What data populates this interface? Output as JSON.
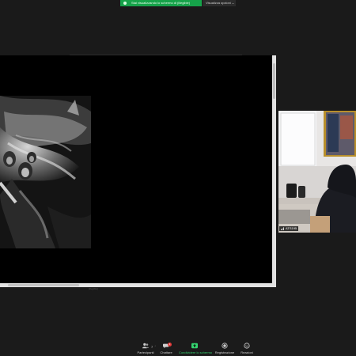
{
  "banner": {
    "text": "Stai visualizzando lo schermo di (illegible)"
  },
  "view_options": {
    "label": "Visualizza opzioni ⌄"
  },
  "shared_screen": {
    "page_label": "(illegible)"
  },
  "participant": {
    "name": "ATS195"
  },
  "toolbar": {
    "participants": {
      "label": "Partecipanti",
      "count": "7"
    },
    "chat": {
      "label": "Chattare",
      "badge": "4"
    },
    "share": {
      "label": "Condividere lo schermo"
    },
    "record": {
      "label": "Registrazione"
    },
    "reactions": {
      "label": "Reazioni"
    }
  },
  "colors": {
    "share_green": "#35d26f",
    "banner_green": "#16a34a",
    "badge_red": "#e23b3b"
  }
}
